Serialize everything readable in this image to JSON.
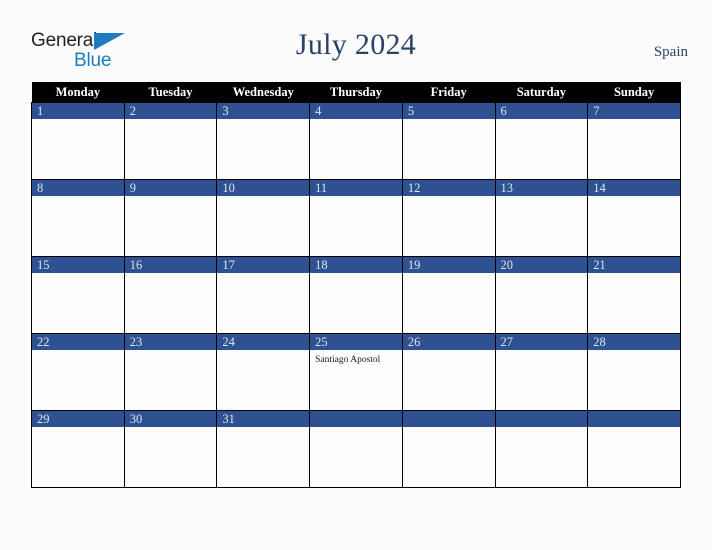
{
  "brand": {
    "name_part1": "General",
    "name_part2": "Blue",
    "triangle_color": "#1b7cc1",
    "text_color": "#231f20"
  },
  "header": {
    "title": "July 2024",
    "country": "Spain",
    "title_color": "#2b4168"
  },
  "calendar": {
    "weekday_headers": [
      "Monday",
      "Tuesday",
      "Wednesday",
      "Thursday",
      "Friday",
      "Saturday",
      "Sunday"
    ],
    "header_bg": "#000000",
    "daybar_bg": "#2e5192",
    "daynum_color": "#dfe4ef",
    "weeks": [
      [
        {
          "day": "1",
          "events": []
        },
        {
          "day": "2",
          "events": []
        },
        {
          "day": "3",
          "events": []
        },
        {
          "day": "4",
          "events": []
        },
        {
          "day": "5",
          "events": []
        },
        {
          "day": "6",
          "events": []
        },
        {
          "day": "7",
          "events": []
        }
      ],
      [
        {
          "day": "8",
          "events": []
        },
        {
          "day": "9",
          "events": []
        },
        {
          "day": "10",
          "events": []
        },
        {
          "day": "11",
          "events": []
        },
        {
          "day": "12",
          "events": []
        },
        {
          "day": "13",
          "events": []
        },
        {
          "day": "14",
          "events": []
        }
      ],
      [
        {
          "day": "15",
          "events": []
        },
        {
          "day": "16",
          "events": []
        },
        {
          "day": "17",
          "events": []
        },
        {
          "day": "18",
          "events": []
        },
        {
          "day": "19",
          "events": []
        },
        {
          "day": "20",
          "events": []
        },
        {
          "day": "21",
          "events": []
        }
      ],
      [
        {
          "day": "22",
          "events": []
        },
        {
          "day": "23",
          "events": []
        },
        {
          "day": "24",
          "events": []
        },
        {
          "day": "25",
          "events": [
            "Santiago Apostol"
          ]
        },
        {
          "day": "26",
          "events": []
        },
        {
          "day": "27",
          "events": []
        },
        {
          "day": "28",
          "events": []
        }
      ],
      [
        {
          "day": "29",
          "events": []
        },
        {
          "day": "30",
          "events": []
        },
        {
          "day": "31",
          "events": []
        },
        {
          "day": "",
          "events": []
        },
        {
          "day": "",
          "events": []
        },
        {
          "day": "",
          "events": []
        },
        {
          "day": "",
          "events": []
        }
      ]
    ]
  }
}
